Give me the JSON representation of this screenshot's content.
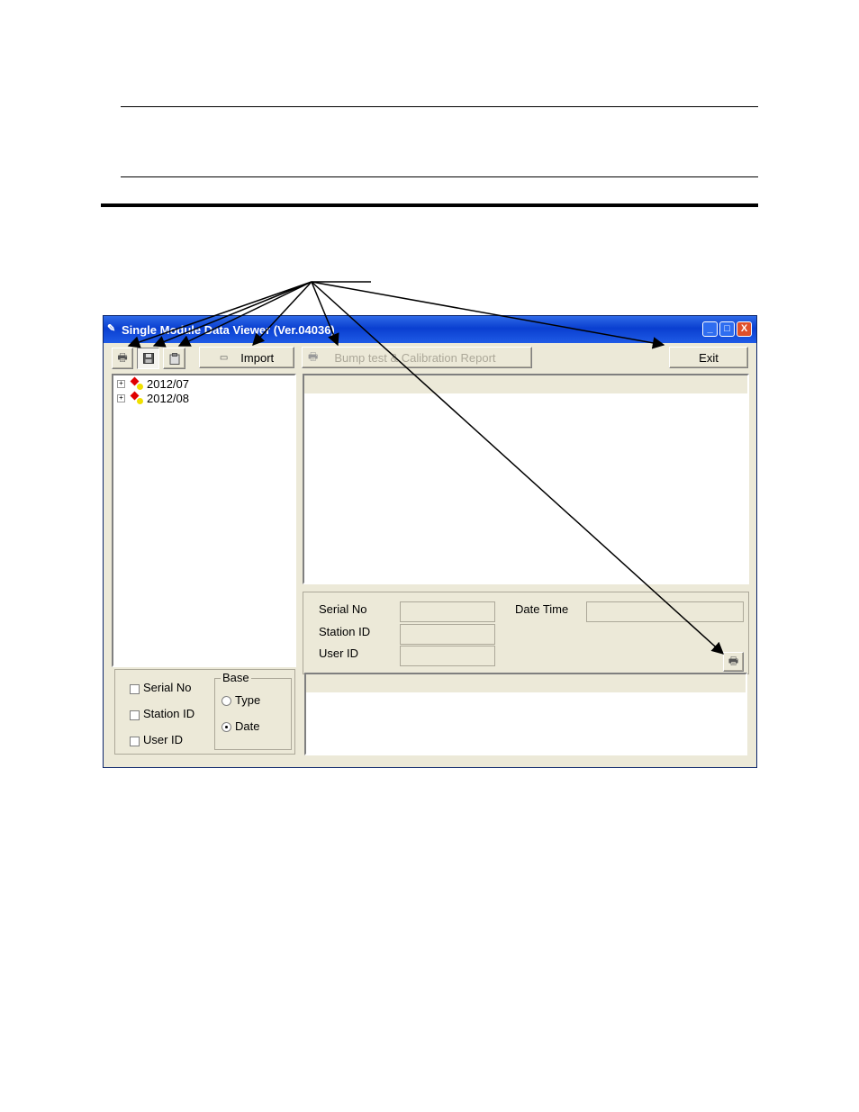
{
  "window": {
    "title": "Single Module Data Viewer (Ver.04036)",
    "controls": {
      "minimize": "_",
      "maximize": "□",
      "close": "X"
    }
  },
  "toolbar": {
    "print_icon": "printer-icon",
    "save_icon": "floppy-disk-icon",
    "clipboard_icon": "clipboard-icon",
    "import_label": "Import",
    "report_label": "Bump test & Calibration Report",
    "exit_label": "Exit"
  },
  "tree": {
    "items": [
      {
        "label": "2012/07",
        "expander": "+"
      },
      {
        "label": "2012/08",
        "expander": "+"
      }
    ]
  },
  "filters": {
    "serial_no": "Serial No",
    "station_id": "Station ID",
    "user_id": "User ID",
    "base_group": "Base",
    "base_type": "Type",
    "base_date": "Date",
    "selected_base": "Date"
  },
  "details": {
    "serial_no_label": "Serial No",
    "station_id_label": "Station ID",
    "user_id_label": "User ID",
    "date_time_label": "Date Time",
    "serial_no_value": "",
    "station_id_value": "",
    "user_id_value": "",
    "date_time_value": ""
  },
  "colors": {
    "titlebar": "#0a3fd0",
    "window_bg": "#ece9d8",
    "close_button": "#e0502a"
  }
}
